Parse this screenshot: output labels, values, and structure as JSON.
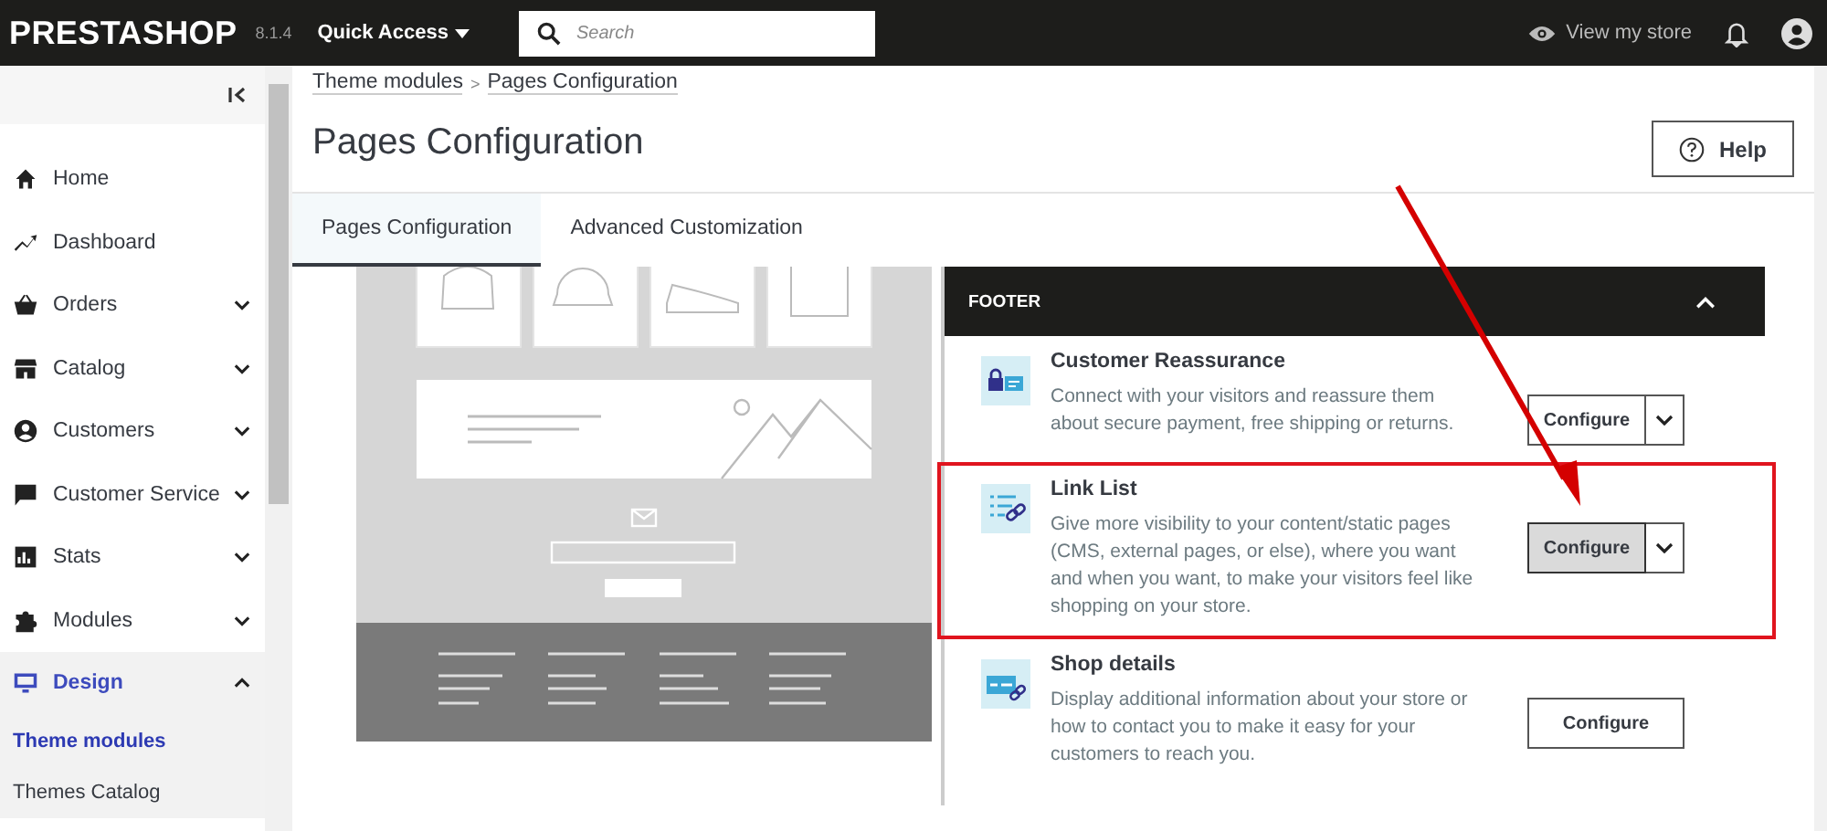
{
  "topbar": {
    "logo": "PRESTASHOP",
    "version": "8.1.4",
    "quick_access": "Quick Access",
    "search": {
      "placeholder": "Search"
    },
    "view_store": "View my store"
  },
  "sidebar": {
    "items": [
      {
        "label": "Home",
        "kind": "link",
        "selected": false
      },
      {
        "label": "Dashboard",
        "kind": "link",
        "selected": false
      },
      {
        "label": "Orders",
        "kind": "menu",
        "expanded": false,
        "selected": false
      },
      {
        "label": "Catalog",
        "kind": "menu",
        "expanded": false,
        "selected": false
      },
      {
        "label": "Customers",
        "kind": "menu",
        "expanded": false,
        "selected": false
      },
      {
        "label": "Customer Service",
        "kind": "menu",
        "expanded": false,
        "selected": false
      },
      {
        "label": "Stats",
        "kind": "menu",
        "expanded": false,
        "selected": false
      },
      {
        "label": "Modules",
        "kind": "menu",
        "expanded": false,
        "selected": false
      },
      {
        "label": "Design",
        "kind": "menu",
        "expanded": true,
        "selected": true,
        "children": [
          {
            "label": "Theme modules",
            "selected": true
          },
          {
            "label": "Themes Catalog",
            "selected": false
          }
        ]
      }
    ]
  },
  "breadcrumb": {
    "items": [
      "Theme modules",
      "Pages Configuration"
    ],
    "separator": ">"
  },
  "page_title": "Pages Configuration",
  "help_button": "Help",
  "tabs": [
    {
      "label": "Pages Configuration",
      "selected": true
    },
    {
      "label": "Advanced Customization",
      "selected": false
    }
  ],
  "footer_panel": {
    "title": "FOOTER",
    "expanded": true,
    "modules": [
      {
        "name": "Customer Reassurance",
        "description": "Connect with your visitors and reassure them about secure payment, free shipping or returns.",
        "button": "Configure",
        "kind": "split",
        "pressed": false,
        "highlighted": false
      },
      {
        "name": "Link List",
        "description": "Give more visibility to your content/static pages (CMS, external pages, or else), where you want and when you want, to make your visitors feel like shopping on your store.",
        "button": "Configure",
        "kind": "split",
        "pressed": true,
        "highlighted": true
      },
      {
        "name": "Shop details",
        "description": "Display additional information about your store or how to contact you to make it easy for your customers to reach you.",
        "button": "Configure",
        "kind": "single",
        "pressed": false,
        "highlighted": false
      }
    ]
  }
}
